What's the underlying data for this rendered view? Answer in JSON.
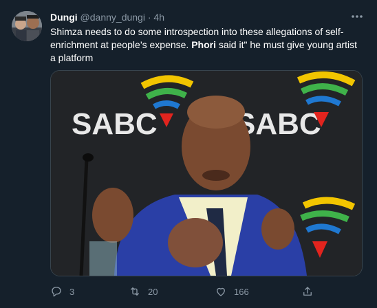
{
  "tweet": {
    "display_name": "Dungi",
    "handle": "@danny_dungi",
    "separator": "·",
    "time": "4h",
    "text_part1": "Shimza needs to do some introspection into these allegations of self-enrichment at people’s expense. ",
    "text_bold": "Phori",
    "text_part2": " said it\" he must give young artist a platform",
    "image_logo_text": "SABC"
  },
  "actions": {
    "reply_count": "3",
    "retweet_count": "20",
    "like_count": "166"
  },
  "colors": {
    "background": "#15202b",
    "secondary_text": "#8b98a5",
    "border": "#38444d"
  },
  "icons": {
    "more": "more-horizontal-icon",
    "reply": "reply-icon",
    "retweet": "retweet-icon",
    "like": "heart-icon",
    "share": "share-icon"
  }
}
